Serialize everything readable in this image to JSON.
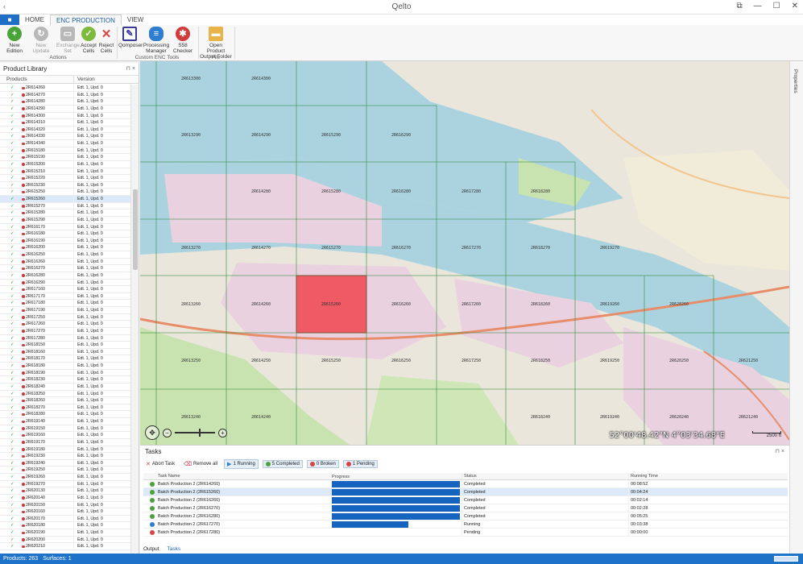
{
  "app": {
    "title": "Qelto",
    "quick_access": "‹",
    "window_controls": [
      "⧉",
      "—",
      "☐",
      "✕"
    ]
  },
  "ribbon": {
    "file_tab": "■",
    "tabs": [
      "HOME",
      "ENC PRODUCTION",
      "VIEW"
    ],
    "active_tab": "ENC PRODUCTION",
    "groups": [
      {
        "label": "Actions",
        "buttons": [
          {
            "label": "New Edition",
            "icon": "plus-icon",
            "enabled": true,
            "color": "#4aa338"
          },
          {
            "label": "New Update",
            "icon": "update-icon",
            "enabled": false,
            "color": "#b8b8b8"
          },
          {
            "label": "Exchange Set",
            "icon": "box-icon",
            "enabled": false,
            "color": "#b8b8b8"
          },
          {
            "label": "Accept Cells",
            "icon": "check-icon",
            "enabled": true,
            "color": "#7cbb3c"
          },
          {
            "label": "Reject Cells",
            "icon": "x-icon",
            "enabled": true,
            "color": "#d64541"
          }
        ]
      },
      {
        "label": "Custom ENC Tools",
        "buttons": [
          {
            "label": "Qomposer",
            "icon": "composer-icon",
            "enabled": true,
            "color": "#3a3a99"
          },
          {
            "label": "Processing Manager",
            "icon": "database-icon",
            "enabled": true,
            "color": "#2f7dd1"
          },
          {
            "label": "S58 Checker",
            "icon": "checker-icon",
            "enabled": true,
            "color": "#d03b3b"
          }
        ]
      },
      {
        "label": "File",
        "buttons": [
          {
            "label": "Open Product Output Folder",
            "icon": "folder-icon",
            "enabled": true,
            "color": "#e8b44a"
          }
        ]
      }
    ]
  },
  "product_library": {
    "title": "Product Library",
    "pin": "⊓ ×",
    "columns": [
      "Products",
      "Version"
    ],
    "selected_index": 16,
    "rows": [
      [
        "2R614260",
        "Edt. 1, Upd. 0"
      ],
      [
        "2R614270",
        "Edt. 1, Upd. 0"
      ],
      [
        "2R614280",
        "Edt. 1, Upd. 0"
      ],
      [
        "2R614290",
        "Edt. 1, Upd. 0"
      ],
      [
        "2R614300",
        "Edt. 1, Upd. 0"
      ],
      [
        "2R614310",
        "Edt. 1, Upd. 0"
      ],
      [
        "2R614320",
        "Edt. 1, Upd. 0"
      ],
      [
        "2R614330",
        "Edt. 1, Upd. 0"
      ],
      [
        "2R614340",
        "Edt. 1, Upd. 0"
      ],
      [
        "2R615180",
        "Edt. 1, Upd. 0"
      ],
      [
        "2R615190",
        "Edt. 1, Upd. 0"
      ],
      [
        "2R615200",
        "Edt. 1, Upd. 0"
      ],
      [
        "2R615210",
        "Edt. 1, Upd. 0"
      ],
      [
        "2R615220",
        "Edt. 1, Upd. 0"
      ],
      [
        "2R615230",
        "Edt. 1, Upd. 0"
      ],
      [
        "2R615250",
        "Edt. 1, Upd. 0"
      ],
      [
        "2R615260",
        "Edt. 1, Upd. 0"
      ],
      [
        "2R615270",
        "Edt. 1, Upd. 0"
      ],
      [
        "2R615280",
        "Edt. 1, Upd. 0"
      ],
      [
        "2R615290",
        "Edt. 1, Upd. 0"
      ],
      [
        "2R616170",
        "Edt. 1, Upd. 0"
      ],
      [
        "2R616180",
        "Edt. 1, Upd. 0"
      ],
      [
        "2R616190",
        "Edt. 1, Upd. 0"
      ],
      [
        "2R616200",
        "Edt. 1, Upd. 0"
      ],
      [
        "2R616250",
        "Edt. 1, Upd. 0"
      ],
      [
        "2R616260",
        "Edt. 1, Upd. 0"
      ],
      [
        "2R616270",
        "Edt. 1, Upd. 0"
      ],
      [
        "2R616280",
        "Edt. 1, Upd. 0"
      ],
      [
        "2R616290",
        "Edt. 1, Upd. 0"
      ],
      [
        "2R617160",
        "Edt. 1, Upd. 0"
      ],
      [
        "2R617170",
        "Edt. 1, Upd. 0"
      ],
      [
        "2R617180",
        "Edt. 1, Upd. 0"
      ],
      [
        "2R617190",
        "Edt. 1, Upd. 0"
      ],
      [
        "2R617250",
        "Edt. 1, Upd. 0"
      ],
      [
        "2R617260",
        "Edt. 1, Upd. 0"
      ],
      [
        "2R617270",
        "Edt. 1, Upd. 0"
      ],
      [
        "2R617280",
        "Edt. 1, Upd. 0"
      ],
      [
        "2R618150",
        "Edt. 1, Upd. 0"
      ],
      [
        "2R618160",
        "Edt. 1, Upd. 0"
      ],
      [
        "2R618170",
        "Edt. 1, Upd. 0"
      ],
      [
        "2R618180",
        "Edt. 1, Upd. 0"
      ],
      [
        "2R618190",
        "Edt. 1, Upd. 0"
      ],
      [
        "2R618230",
        "Edt. 1, Upd. 0"
      ],
      [
        "2R618240",
        "Edt. 1, Upd. 0"
      ],
      [
        "2R618250",
        "Edt. 1, Upd. 0"
      ],
      [
        "2R618260",
        "Edt. 1, Upd. 0"
      ],
      [
        "2R618270",
        "Edt. 1, Upd. 0"
      ],
      [
        "2R618280",
        "Edt. 1, Upd. 0"
      ],
      [
        "2R619140",
        "Edt. 1, Upd. 0"
      ],
      [
        "2R619150",
        "Edt. 1, Upd. 0"
      ],
      [
        "2R619160",
        "Edt. 1, Upd. 0"
      ],
      [
        "2R619170",
        "Edt. 1, Upd. 0"
      ],
      [
        "2R619180",
        "Edt. 1, Upd. 0"
      ],
      [
        "2R619230",
        "Edt. 1, Upd. 0"
      ],
      [
        "2R619240",
        "Edt. 1, Upd. 0"
      ],
      [
        "2R619250",
        "Edt. 1, Upd. 0"
      ],
      [
        "2R619260",
        "Edt. 1, Upd. 0"
      ],
      [
        "2R619270",
        "Edt. 1, Upd. 0"
      ],
      [
        "2R620130",
        "Edt. 1, Upd. 0"
      ],
      [
        "2R620140",
        "Edt. 1, Upd. 0"
      ],
      [
        "2R620150",
        "Edt. 1, Upd. 0"
      ],
      [
        "2R620160",
        "Edt. 1, Upd. 0"
      ],
      [
        "2R620170",
        "Edt. 1, Upd. 0"
      ],
      [
        "2R620180",
        "Edt. 1, Upd. 0"
      ],
      [
        "2R620190",
        "Edt. 1, Upd. 0"
      ],
      [
        "2R620200",
        "Edt. 1, Upd. 0"
      ],
      [
        "2R620210",
        "Edt. 1, Upd. 0"
      ]
    ]
  },
  "map": {
    "cells": [
      {
        "label": "2R613300",
        "row": 0,
        "col": 0
      },
      {
        "label": "2R614300",
        "row": 0,
        "col": 1
      },
      {
        "label": "2R613290",
        "row": 1,
        "col": 0
      },
      {
        "label": "2R614290",
        "row": 1,
        "col": 1
      },
      {
        "label": "2R615290",
        "row": 1,
        "col": 2
      },
      {
        "label": "2R616290",
        "row": 1,
        "col": 3
      },
      {
        "label": "2R614280",
        "row": 2,
        "col": 1
      },
      {
        "label": "2R615280",
        "row": 2,
        "col": 2
      },
      {
        "label": "2R616280",
        "row": 2,
        "col": 3
      },
      {
        "label": "2R617280",
        "row": 2,
        "col": 4
      },
      {
        "label": "2R618280",
        "row": 2,
        "col": 5
      },
      {
        "label": "2R613270",
        "row": 3,
        "col": 0
      },
      {
        "label": "2R614270",
        "row": 3,
        "col": 1
      },
      {
        "label": "2R615270",
        "row": 3,
        "col": 2
      },
      {
        "label": "2R616270",
        "row": 3,
        "col": 3
      },
      {
        "label": "2R617270",
        "row": 3,
        "col": 4
      },
      {
        "label": "2R618270",
        "row": 3,
        "col": 5
      },
      {
        "label": "2R619270",
        "row": 3,
        "col": 6
      },
      {
        "label": "2R613260",
        "row": 4,
        "col": 0
      },
      {
        "label": "2R614260",
        "row": 4,
        "col": 1
      },
      {
        "label": "2R615260",
        "row": 4,
        "col": 2,
        "highlight": true
      },
      {
        "label": "2R616260",
        "row": 4,
        "col": 3
      },
      {
        "label": "2R617260",
        "row": 4,
        "col": 4
      },
      {
        "label": "2R618260",
        "row": 4,
        "col": 5
      },
      {
        "label": "2R619260",
        "row": 4,
        "col": 6
      },
      {
        "label": "2R620260",
        "row": 4,
        "col": 7
      },
      {
        "label": "2R613250",
        "row": 5,
        "col": 0
      },
      {
        "label": "2R614250",
        "row": 5,
        "col": 1
      },
      {
        "label": "2R615250",
        "row": 5,
        "col": 2
      },
      {
        "label": "2R616250",
        "row": 5,
        "col": 3
      },
      {
        "label": "2R617250",
        "row": 5,
        "col": 4
      },
      {
        "label": "2R618250",
        "row": 5,
        "col": 5
      },
      {
        "label": "2R619250",
        "row": 5,
        "col": 6
      },
      {
        "label": "2R620250",
        "row": 5,
        "col": 7
      },
      {
        "label": "2R621250",
        "row": 5,
        "col": 8
      },
      {
        "label": "2R613240",
        "row": 6,
        "col": 0
      },
      {
        "label": "2R614240",
        "row": 6,
        "col": 1
      },
      {
        "label": "2R618240",
        "row": 6,
        "col": 5
      },
      {
        "label": "2R619240",
        "row": 6,
        "col": 6
      },
      {
        "label": "2R620240",
        "row": 6,
        "col": 7
      },
      {
        "label": "2R621240",
        "row": 6,
        "col": 8
      }
    ],
    "highlight_color": "#f0323c",
    "water_color": "#aad3df",
    "land_color": "#eae6dc",
    "industrial_color": "#e9d1e0",
    "green_color": "#c9e3b0",
    "coordinates": "52°00'48.42\"N  4°03'34.68\"E",
    "scale": "2500 ft"
  },
  "side_panel": {
    "label": "Properties"
  },
  "tasks": {
    "title": "Tasks",
    "pin": "⊓ ×",
    "toolbar": [
      {
        "label": "Abort Task",
        "icon": "abort-icon",
        "color": "#d64541",
        "filter": false
      },
      {
        "label": "Remove all",
        "icon": "remove-icon",
        "color": "#888888",
        "filter": false
      },
      {
        "label": "1 Running",
        "icon": "running-icon",
        "color": "#2f7dd1",
        "filter": true
      },
      {
        "label": "5 Completed",
        "icon": "completed-icon",
        "color": "#4aa338",
        "filter": true
      },
      {
        "label": "0 Broken",
        "icon": "broken-icon",
        "color": "#d64541",
        "filter": true
      },
      {
        "label": "1 Pending",
        "icon": "pending-icon",
        "color": "#d64541",
        "filter": true
      }
    ],
    "columns": [
      "Task Name",
      "Progress",
      "Status",
      "Running Time"
    ],
    "selected_index": 1,
    "rows": [
      {
        "name": "Batch Production 2 (2R614260)",
        "progress": 1.0,
        "status": "Completed",
        "time": "00:08:52",
        "state": "completed"
      },
      {
        "name": "Batch Production 2 (2R615260)",
        "progress": 1.0,
        "status": "Completed",
        "time": "00:04:24",
        "state": "completed"
      },
      {
        "name": "Batch Production 2 (2R616260)",
        "progress": 1.0,
        "status": "Completed",
        "time": "00:02:14",
        "state": "completed"
      },
      {
        "name": "Batch Production 2 (2R616270)",
        "progress": 1.0,
        "status": "Completed",
        "time": "00:02:28",
        "state": "completed"
      },
      {
        "name": "Batch Production 2 (2R616280)",
        "progress": 1.0,
        "status": "Completed",
        "time": "00:05:25",
        "state": "completed"
      },
      {
        "name": "Batch Production 2 (2R617270)",
        "progress": 0.6,
        "status": "Running",
        "time": "00:03:38",
        "state": "running"
      },
      {
        "name": "Batch Production 2 (2R617280)",
        "progress": 0,
        "status": "Pending",
        "time": "00:00:00",
        "state": "pending"
      }
    ],
    "bottom_tabs": [
      "Output",
      "Tasks"
    ],
    "active_bottom_tab": "Tasks"
  },
  "statusbar": {
    "products": "Products: 263",
    "surfaces": "Surfaces: 1"
  }
}
